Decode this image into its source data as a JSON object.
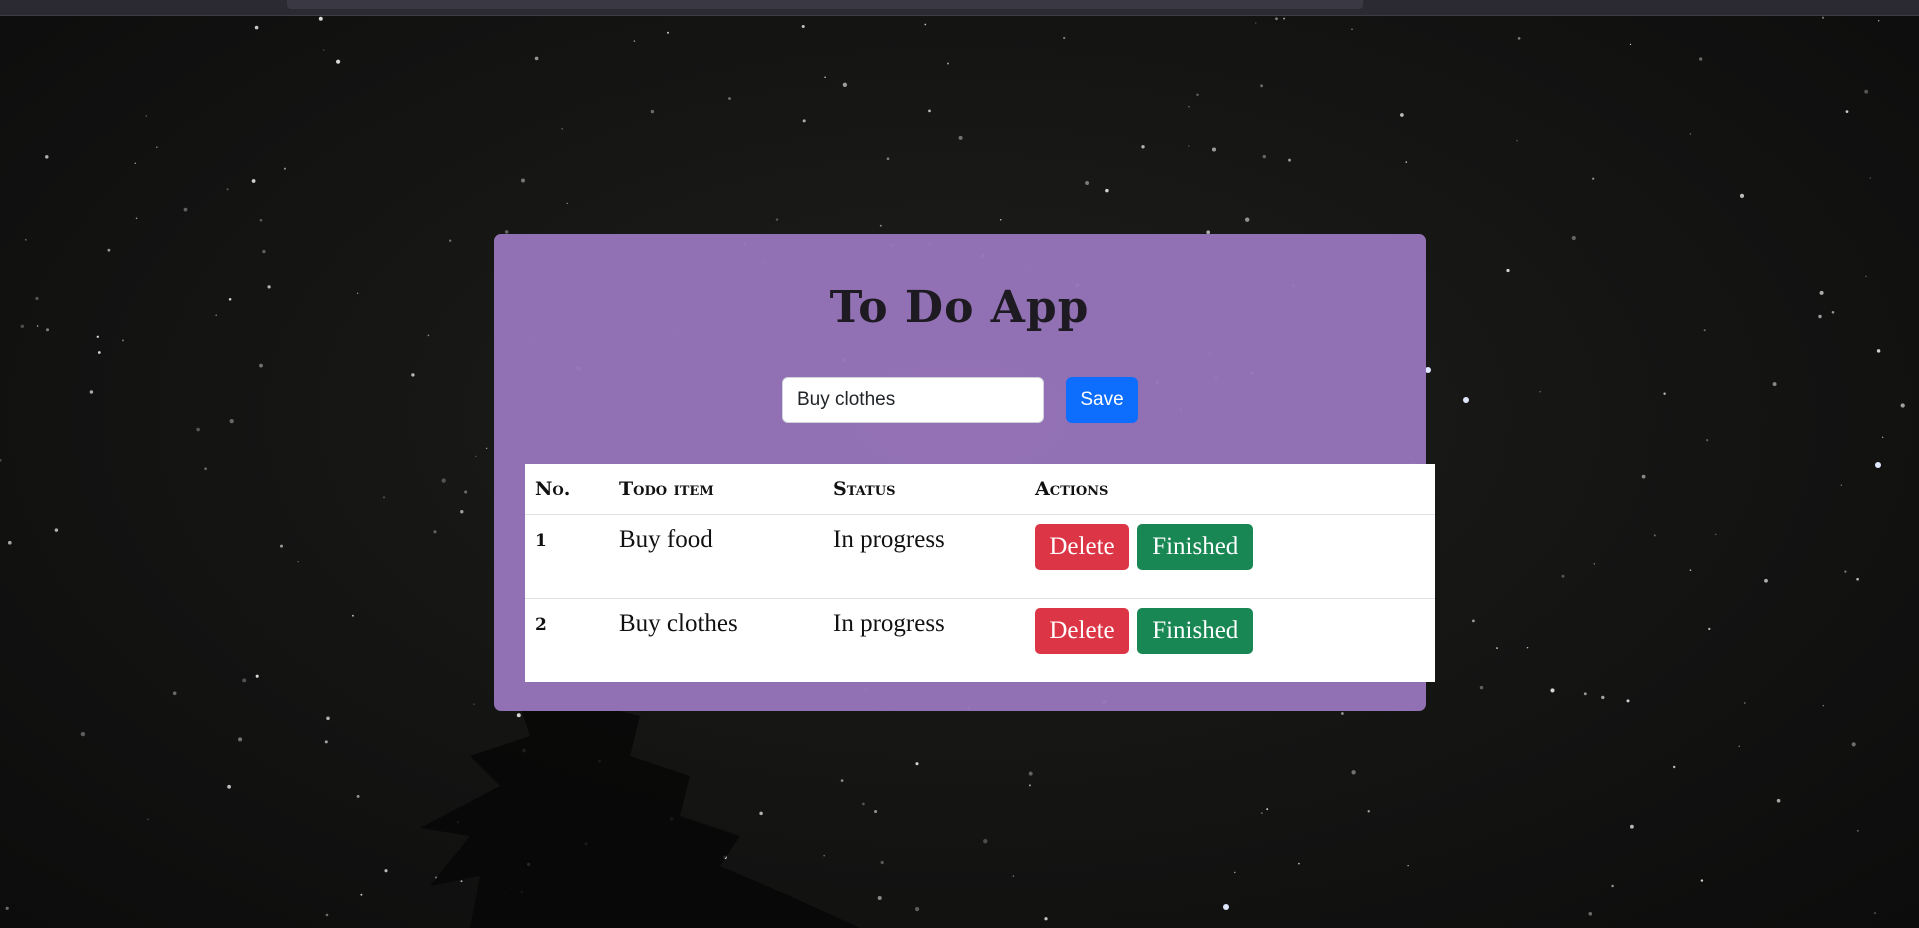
{
  "app": {
    "title": "To Do App"
  },
  "form": {
    "input_value": "Buy clothes",
    "save_label": "Save"
  },
  "table": {
    "headers": [
      "No.",
      "Todo item",
      "Status",
      "Actions"
    ],
    "rows": [
      {
        "no": "1",
        "item": "Buy food",
        "status": "In progress",
        "delete_label": "Delete",
        "finished_label": "Finished"
      },
      {
        "no": "2",
        "item": "Buy clothes",
        "status": "In progress",
        "delete_label": "Delete",
        "finished_label": "Finished"
      }
    ]
  },
  "colors": {
    "card": "#9774ba",
    "save": "#0d6efd",
    "delete": "#dc3545",
    "finished": "#198754",
    "background": "#141413"
  }
}
